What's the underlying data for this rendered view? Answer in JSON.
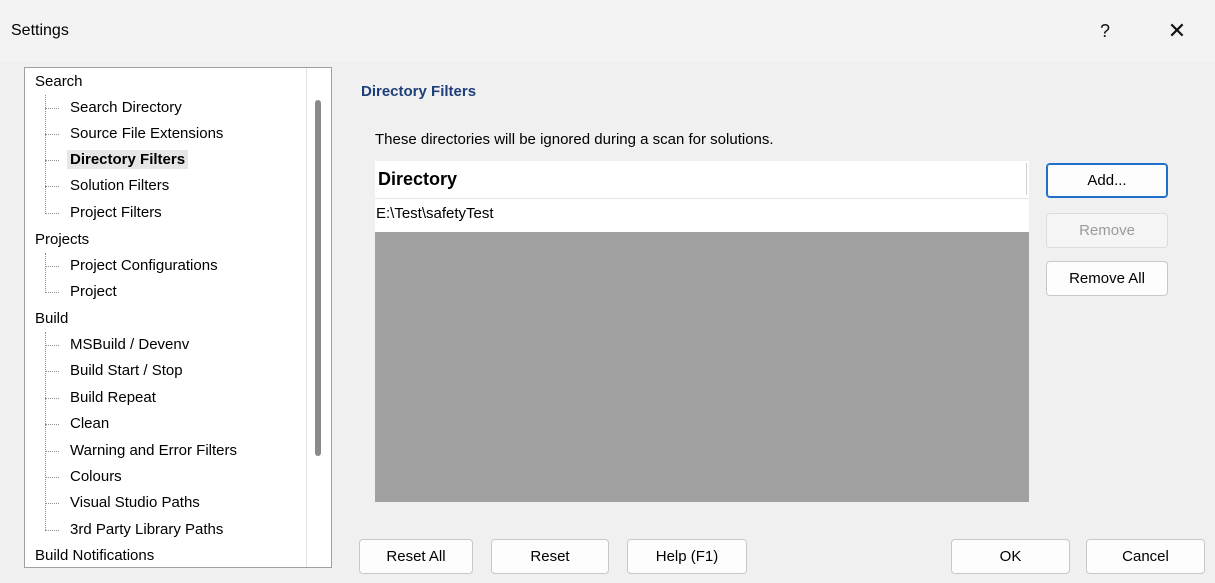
{
  "window": {
    "title": "Settings",
    "help_label": "?",
    "close_label": "✕"
  },
  "tree": {
    "groups": [
      {
        "label": "Search",
        "items": [
          "Search Directory",
          "Source File Extensions",
          "Directory Filters",
          "Solution Filters",
          "Project Filters"
        ]
      },
      {
        "label": "Projects",
        "items": [
          "Project Configurations",
          "Project"
        ]
      },
      {
        "label": "Build",
        "items": [
          "MSBuild / Devenv",
          "Build Start / Stop",
          "Build Repeat",
          "Clean",
          "Warning and Error Filters",
          "Colours",
          "Visual Studio Paths",
          "3rd Party Library Paths"
        ]
      },
      {
        "label": "Build Notifications",
        "items": []
      }
    ],
    "selected": "Directory Filters"
  },
  "panel": {
    "title": "Directory Filters",
    "description": "These directories will be ignored during a scan for solutions.",
    "column_header": "Directory",
    "rows": [
      "E:\\Test\\safetyTest"
    ],
    "add_label": "Add...",
    "remove_label": "Remove",
    "remove_all_label": "Remove All"
  },
  "footer": {
    "reset_all_label": "Reset All",
    "reset_label": "Reset",
    "help_label": "Help (F1)",
    "ok_label": "OK",
    "cancel_label": "Cancel"
  }
}
